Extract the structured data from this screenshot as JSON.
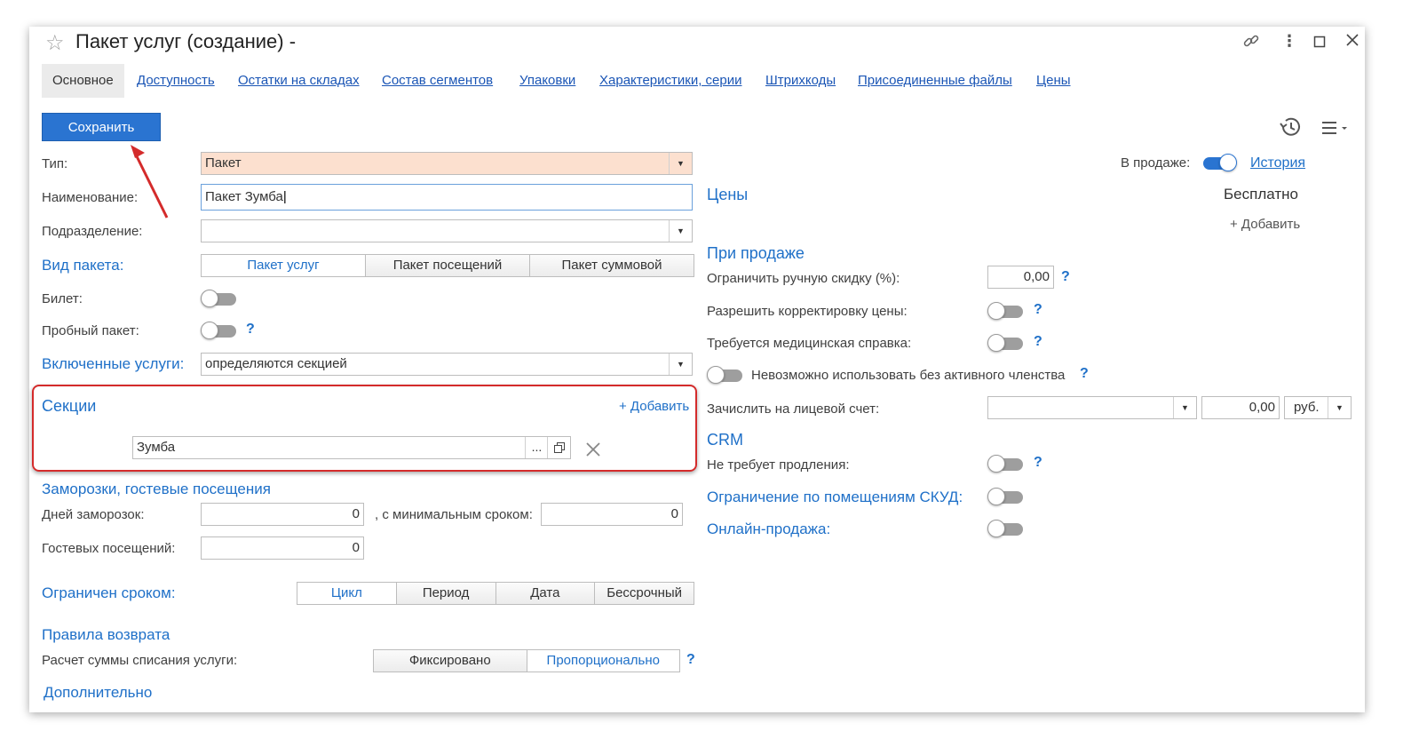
{
  "window": {
    "title": "Пакет услуг (создание) -",
    "icons": [
      "star-icon",
      "link-icon",
      "more-icon",
      "maximize-icon",
      "close-icon"
    ]
  },
  "tabs": [
    {
      "label": "Основное",
      "active": true
    },
    {
      "label": "Доступность"
    },
    {
      "label": "Остатки на складах"
    },
    {
      "label": "Состав сегментов"
    },
    {
      "label": "Упаковки"
    },
    {
      "label": "Характеристики, серии"
    },
    {
      "label": "Штрихкоды"
    },
    {
      "label": "Присоединенные файлы"
    },
    {
      "label": "Цены"
    }
  ],
  "toolbar": {
    "save_label": "Сохранить"
  },
  "left": {
    "type_label": "Тип:",
    "type_value": "Пакет",
    "name_label": "Наименование:",
    "name_value": "Пакет Зумба",
    "division_label": "Подразделение:",
    "division_value": "",
    "kind_label": "Вид пакета:",
    "kind_options": [
      "Пакет услуг",
      "Пакет посещений",
      "Пакет суммовой"
    ],
    "kind_selected": "Пакет услуг",
    "ticket_label": "Билет:",
    "ticket_on": false,
    "trial_label": "Пробный пакет:",
    "trial_on": false,
    "help": "?",
    "included_label": "Включенные услуги:",
    "included_value": "определяются секцией",
    "sections_title": "Секции",
    "add_label": "+ Добавить",
    "section_value": "Зумба",
    "ellipsis": "...",
    "freeze_title": "Заморозки, гостевые посещения",
    "freeze_days_label": "Дней заморозок:",
    "freeze_days_value": "0",
    "min_term_label": ", с минимальным сроком:",
    "min_term_value": "0",
    "guest_label": "Гостевых посещений:",
    "guest_value": "0",
    "term_label": "Ограничен сроком:",
    "term_options": [
      "Цикл",
      "Период",
      "Дата",
      "Бессрочный"
    ],
    "term_selected": "Цикл",
    "refund_title": "Правила возврата",
    "refund_calc_label": "Расчет суммы списания услуги:",
    "refund_options": [
      "Фиксировано",
      "Пропорционально"
    ],
    "refund_selected": "Пропорционально",
    "extra_title": "Дополнительно"
  },
  "right": {
    "on_sale_label": "В продаже:",
    "on_sale": true,
    "history_link": "История",
    "prices_title": "Цены",
    "free_label": "Бесплатно",
    "add_label": "+ Добавить",
    "on_sale_title": "При продаже",
    "discount_label": "Ограничить ручную скидку (%):",
    "discount_value": "0,00",
    "price_edit_label": "Разрешить корректировку цены:",
    "price_edit_on": false,
    "med_label": "Требуется медицинская справка:",
    "med_on": false,
    "membership_label": "Невозможно использовать без активного членства",
    "membership_on": false,
    "account_label": "Зачислить на лицевой счет:",
    "account_value": "",
    "account_amount": "0,00",
    "currency": "руб.",
    "crm_title": "CRM",
    "no_renew_label": "Не требует продления:",
    "no_renew_on": false,
    "skud_label": "Ограничение по помещениям СКУД:",
    "skud_on": false,
    "online_label": "Онлайн-продажа:",
    "online_on": false,
    "help": "?"
  },
  "colors": {
    "accent": "#1f70c8",
    "save_button": "#2a74d1",
    "type_field_bg": "#fce0cf",
    "highlight_border": "#d42b2b"
  }
}
